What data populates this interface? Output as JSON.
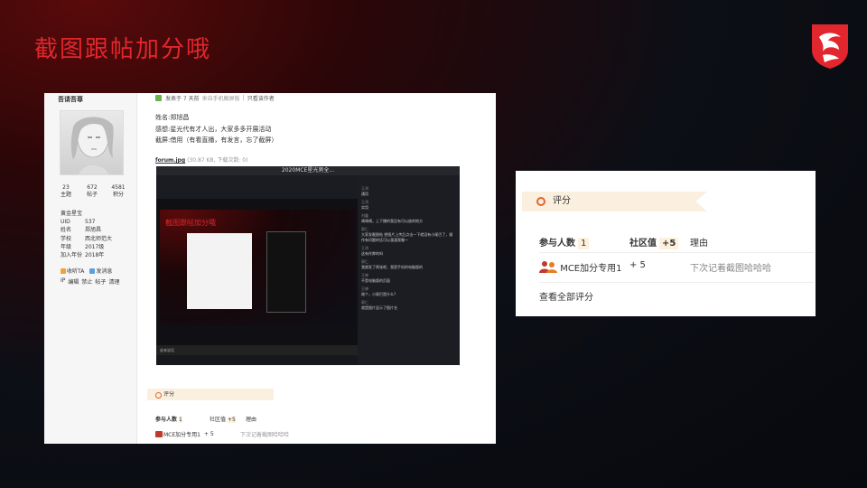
{
  "slide": {
    "title": "截图跟帖加分哦",
    "brand_color": "#e2262d"
  },
  "left_screenshot": {
    "user": {
      "name": "吾请吾尊",
      "stats": [
        {
          "value": "23",
          "label": "主题"
        },
        {
          "value": "672",
          "label": "帖子"
        },
        {
          "value": "4581",
          "label": "积分"
        }
      ],
      "group": "黄金星宝",
      "info": [
        {
          "key": "UID",
          "value": "537"
        },
        {
          "key": "姓名",
          "value": "郑旭昌"
        },
        {
          "key": "学校",
          "value": "西北师范大"
        },
        {
          "key": "年级",
          "value": "2017级"
        },
        {
          "key": "加入年份",
          "value": "2018年"
        }
      ],
      "actions": [
        "收听TA",
        "发消息"
      ],
      "admin": [
        "IP",
        "编辑",
        "禁止",
        "帖子",
        "清理"
      ]
    },
    "post": {
      "header": "发表于 7 天前",
      "header_extra": "来自手机触屏版",
      "author_only": "只看该作者",
      "lines": [
        "姓名:郑旭昌",
        "感想:星光代有才人出，大家多多开展活动",
        "截屏:借用（有看直播，有发言，忘了截屏）"
      ],
      "attachment_name": "forum.jpg",
      "attachment_meta": "(30.87 KB, 下载次数: 0)"
    },
    "embed": {
      "window_title": "2020MCE星光男全...",
      "slide_title": "截图跟帖加分哦",
      "bottom_text": "谁来说话",
      "chat": [
        {
          "user": "王鸿",
          "text": "通用"
        },
        {
          "user": "王鸿",
          "text": "实用"
        },
        {
          "user": "刘鑫",
          "text": "嘀嘀嘀，上下播的我没有可以放的地方"
        },
        {
          "user": "郭仁",
          "text": "大家发截图帖 把图片上传后点击一下就没有小尾巴了，操作有问题的话可以溜溜我喔～"
        },
        {
          "user": "王鸿",
          "text": "这有作弊的吗"
        },
        {
          "user": "郭仁",
          "text": "我就发了两张吧，我是手机的电脑版的"
        },
        {
          "user": "王婷",
          "text": "不是电脑版的页面"
        },
        {
          "user": "王婷",
          "text": "刚个，小尾巴是什么?"
        },
        {
          "user": "郭仁",
          "text": "就是图片显示了图片名"
        }
      ]
    },
    "rating": {
      "label": "评分",
      "participants_label": "参与人数",
      "participants_value": "1",
      "community_label": "社区值",
      "community_value": "+5",
      "reason_label": "理由",
      "rater": "MCE加分专用1",
      "rater_value": "+ 5",
      "rater_reason": "下次记着截图哈哈哈"
    }
  },
  "right_panel": {
    "label": "评分",
    "participants_label": "参与人数",
    "participants_value": "1",
    "community_label": "社区值",
    "community_value": "+5",
    "reason_label": "理由",
    "rater": "MCE加分专用1",
    "rater_value": "+ 5",
    "rater_reason": "下次记着截图哈哈哈",
    "view_all": "查看全部评分"
  },
  "colors": {
    "accent_orange": "#e8632b",
    "rating_bg": "#fbf0df"
  }
}
